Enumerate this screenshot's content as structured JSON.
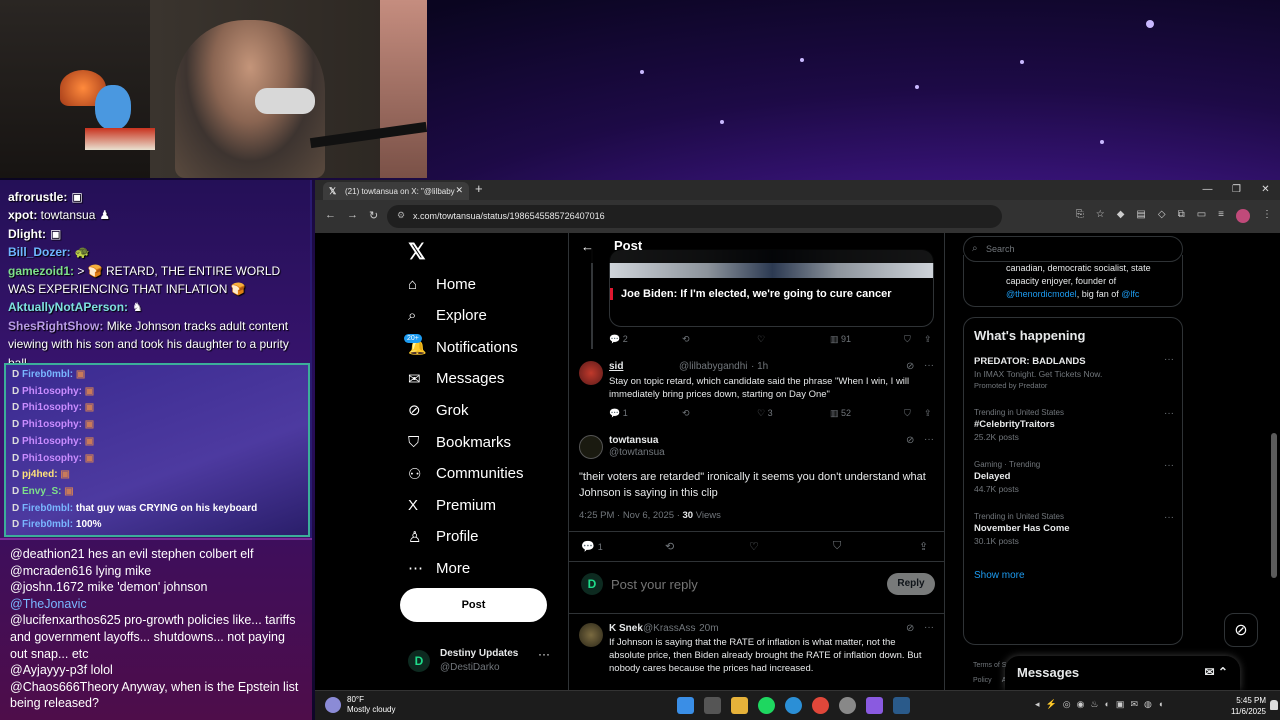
{
  "chat_top": [
    {
      "user": "afrorustle:",
      "msg": "",
      "color": "#ffffff",
      "emote": "▣"
    },
    {
      "user": "xpot:",
      "msg": "towtansua",
      "color": "#ffffff",
      "emote": "♟"
    },
    {
      "user": "Dlight:",
      "msg": "",
      "color": "#ffffff",
      "emote": "▣"
    },
    {
      "user": "Bill_Dozer:",
      "msg": "",
      "color": "#6fb7ff",
      "emote": "🐢"
    },
    {
      "user": "gamezoid1:",
      "msg": "> 🍞 RETARD, THE ENTIRE WORLD WAS EXPERIENCING THAT INFLATION 🍞",
      "color": "#7ee08a",
      "emote": ""
    },
    {
      "user": "AktuallyNotAPerson:",
      "msg": "",
      "color": "#7ee0e0",
      "emote": "♞"
    },
    {
      "user": "ShesRightShow:",
      "msg": "Mike Johnson tracks adult content viewing with his son and took his daughter to a purity ball",
      "color": "#b89ce6",
      "emote": ""
    }
  ],
  "chat_mid": [
    {
      "user": "Fireb0mbl:",
      "msg": "",
      "color": "#79b6ff"
    },
    {
      "user": "Phi1osophy:",
      "msg": "",
      "color": "#c98cff"
    },
    {
      "user": "Phi1osophy:",
      "msg": "",
      "color": "#c98cff"
    },
    {
      "user": "Phi1osophy:",
      "msg": "",
      "color": "#c98cff"
    },
    {
      "user": "Phi1osophy:",
      "msg": "",
      "color": "#c98cff"
    },
    {
      "user": "Phi1osophy:",
      "msg": "",
      "color": "#c98cff"
    },
    {
      "user": "pj4hed:",
      "msg": "",
      "color": "#ffe27a"
    },
    {
      "user": "Envy_S:",
      "msg": "",
      "color": "#7ee08a"
    },
    {
      "user": "Fireb0mbl:",
      "msg": "that guy was CRYING on his keyboard",
      "color": "#79b6ff"
    },
    {
      "user": "Fireb0mbl:",
      "msg": "100%",
      "color": "#79b6ff"
    }
  ],
  "chat_bottom": [
    {
      "user": "@deathion21",
      "msg": "hes an evil stephen colbert elf",
      "color": "#ffffff"
    },
    {
      "user": "@mcraden616",
      "msg": "lying mike",
      "color": "#ffffff"
    },
    {
      "user": "@joshn.1672",
      "msg": "mike 'demon' johnson",
      "color": "#ffffff"
    },
    {
      "user": "@TheJonavic",
      "msg": "",
      "color": "#7ab8ff"
    },
    {
      "user": "@lucifenxarthos625",
      "msg": "pro-growth policies like... tariffs and government layoffs... shutdowns... not paying out snap... etc",
      "color": "#ffffff"
    },
    {
      "user": "@Ayjayyy-p3f",
      "msg": "lolol",
      "color": "#ffffff"
    },
    {
      "user": "@Chaos666Theory",
      "msg": "Anyway, when is the Epstein list being released?",
      "color": "#ffffff"
    }
  ],
  "browser": {
    "tab_title": "(21) towtansua on X: \"@lilbaby",
    "url": "x.com/towtansua/status/1986545585726407016"
  },
  "nav": {
    "items": [
      {
        "label": "Home",
        "icon": "home-icon",
        "glyph": "⌂"
      },
      {
        "label": "Explore",
        "icon": "search-icon",
        "glyph": "⌕"
      },
      {
        "label": "Notifications",
        "icon": "bell-icon",
        "glyph": "🔔"
      },
      {
        "label": "Messages",
        "icon": "mail-icon",
        "glyph": "✉"
      },
      {
        "label": "Grok",
        "icon": "grok-icon",
        "glyph": "⊘"
      },
      {
        "label": "Bookmarks",
        "icon": "bookmark-icon",
        "glyph": "⛉"
      },
      {
        "label": "Communities",
        "icon": "people-icon",
        "glyph": "⚇"
      },
      {
        "label": "Premium",
        "icon": "x-premium-icon",
        "glyph": "X"
      },
      {
        "label": "Profile",
        "icon": "person-icon",
        "glyph": "♙"
      },
      {
        "label": "More",
        "icon": "more-circle-icon",
        "glyph": "⋯"
      }
    ],
    "notif_badge": "20+",
    "post_button": "Post",
    "account": {
      "name": "Destiny Updates",
      "handle": "@DestiDarko"
    }
  },
  "header": {
    "title": "Post"
  },
  "quoted": {
    "caption": "Joe Biden: If I'm elected, we're going to cure cancer",
    "replies": "2",
    "likes": "",
    "views": "91"
  },
  "tweet_sid": {
    "name": "sid",
    "handle": "@lilbabygandhi",
    "time": "· 1h",
    "text": "Stay on topic retard, which candidate said the phrase \"When I win, I will immediately bring prices down, starting on Day One\"",
    "replies": "1",
    "likes": "3",
    "views": "52"
  },
  "focus": {
    "name": "towtansua",
    "handle": "@towtansua",
    "text": "\"their voters are retarded\" ironically it seems you don't understand what Johnson is saying in this clip",
    "time": "4:25 PM · Nov 6, 2025 · ",
    "views_count": "30",
    "views_label": " Views",
    "replies": "1"
  },
  "reply": {
    "placeholder": "Post your reply",
    "button": "Reply"
  },
  "tweet_ksnek": {
    "name": "K Snek",
    "handle": "@KrassAss",
    "time": "· 20m",
    "text": "If Johnson is saying that the RATE of inflation is what matter, not the absolute price, then Biden already brought the RATE of inflation down. But nobody cares because the prices had increased.",
    "likes": "2",
    "views": "10"
  },
  "sidebar": {
    "search_placeholder": "Search",
    "bio_line1": "canadian, democratic socialist, state capacity enjoyer, founder of",
    "bio_link1": "@thenordicmodel",
    "bio_mid": ", big fan of",
    "bio_link2": "@lfc",
    "happening_title": "What's happening",
    "trends": [
      {
        "ctx": "",
        "name": "PREDATOR: BADLANDS",
        "sub": "In IMAX Tonight. Get Tickets Now.",
        "sub2": "Promoted by Predator"
      },
      {
        "ctx": "Trending in United States",
        "name": "#CelebrityTraitors",
        "sub": "25.2K posts",
        "sub2": ""
      },
      {
        "ctx": "Gaming · Trending",
        "name": "Delayed",
        "sub": "44.7K posts",
        "sub2": ""
      },
      {
        "ctx": "Trending in United States",
        "name": "November Has Come",
        "sub": "30.1K posts",
        "sub2": ""
      }
    ],
    "show_more": "Show more",
    "footer": [
      "Terms of Service",
      "Privacy Policy",
      "Cookie Policy",
      "Accessibility",
      "Ads info",
      "More ···",
      "© 2025 X Corp."
    ],
    "messages_drawer": "Messages"
  },
  "taskbar": {
    "temp": "80°F",
    "weather": "Mostly cloudy",
    "time": "5:45 PM",
    "date": "11/6/2025"
  }
}
